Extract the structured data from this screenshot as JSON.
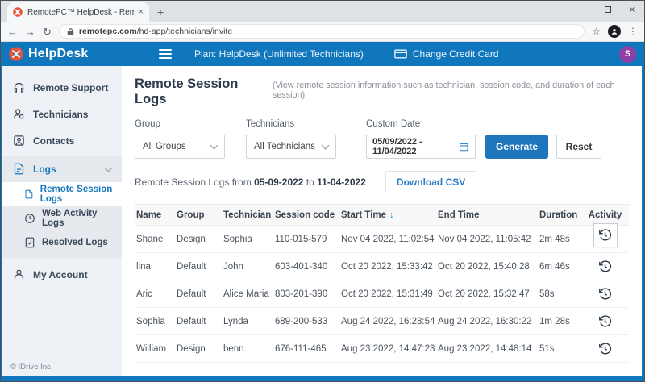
{
  "browser": {
    "tab_title": "RemotePC™ HelpDesk - Remote",
    "tab_close": "×",
    "new_tab": "+",
    "back": "←",
    "forward": "→",
    "refresh": "↻",
    "url": "remotepc.com",
    "url_path": "/hd-app/technicians/invite",
    "star": "☆",
    "menu": "⋮",
    "close": "×"
  },
  "header": {
    "brand": "HelpDesk",
    "plan": "Plan: HelpDesk (Unlimited Technicians)",
    "change_credit_card": "Change Credit Card",
    "avatar_initial": "S"
  },
  "sidebar": {
    "items": [
      {
        "label": "Remote Support"
      },
      {
        "label": "Technicians"
      },
      {
        "label": "Contacts"
      },
      {
        "label": "Logs"
      }
    ],
    "logs_children": [
      {
        "label": "Remote Session Logs"
      },
      {
        "label": "Web Activity Logs"
      },
      {
        "label": "Resolved Logs"
      }
    ],
    "my_account": "My Account",
    "copyright": "© IDrive Inc."
  },
  "page": {
    "title": "Remote Session Logs",
    "subtitle": "(View remote session information such as technician, session code, and duration of each session)"
  },
  "filters": {
    "group_label": "Group",
    "group_value": "All Groups",
    "technicians_label": "Technicians",
    "technicians_value": "All Technicians",
    "date_label": "Custom Date",
    "date_value": "05/09/2022 - 11/04/2022",
    "generate": "Generate",
    "reset": "Reset"
  },
  "summary": {
    "prefix": "Remote Session Logs from",
    "from_date": "05-09-2022",
    "middle": "to",
    "to_date": "11-04-2022",
    "download_csv": "Download CSV"
  },
  "table": {
    "columns": [
      "Name",
      "Group",
      "Technician",
      "Session code",
      "Start Time",
      "End Time",
      "Duration",
      "Activity"
    ],
    "sort_arrow": "↓",
    "rows": [
      {
        "name": "Shane",
        "group": "Design",
        "technician": "Sophia",
        "session_code": "110-015-579",
        "start": "Nov 04 2022, 11:02:54",
        "end": "Nov 04 2022, 11:05:42",
        "duration": "2m 48s"
      },
      {
        "name": "lina",
        "group": "Default",
        "technician": "John",
        "session_code": "603-401-340",
        "start": "Oct 20 2022, 15:33:42",
        "end": "Oct 20 2022, 15:40:28",
        "duration": "6m 46s"
      },
      {
        "name": "Aric",
        "group": "Default",
        "technician": "Alice Maria",
        "session_code": "803-201-390",
        "start": "Oct 20 2022, 15:31:49",
        "end": "Oct 20 2022, 15:32:47",
        "duration": "58s"
      },
      {
        "name": "Sophia",
        "group": "Default",
        "technician": "Lynda",
        "session_code": "689-200-533",
        "start": "Aug 24 2022, 16:28:54",
        "end": "Aug 24 2022, 16:30:22",
        "duration": "1m 28s"
      },
      {
        "name": "William",
        "group": "Design",
        "technician": "benn",
        "session_code": "676-111-465",
        "start": "Aug 23 2022, 14:47:23",
        "end": "Aug 23 2022, 14:48:14",
        "duration": "51s"
      }
    ]
  },
  "colors": {
    "header_blue": "#1177bd",
    "accent_blue": "#1478be",
    "logo_red": "#e8533a",
    "avatar_purple": "#8e3fa8"
  }
}
